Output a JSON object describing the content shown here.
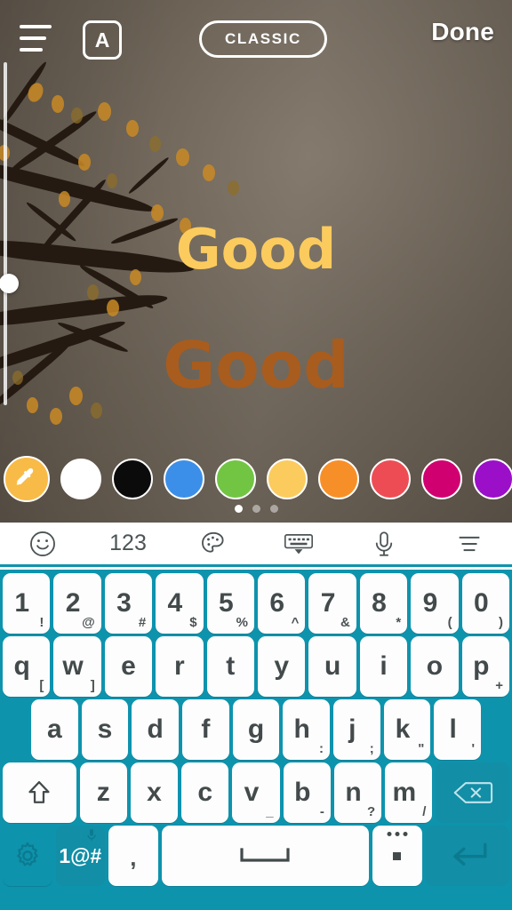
{
  "topbar": {
    "menu_icon": "hamburger-icon",
    "align_label": "A",
    "style_label": "CLASSIC",
    "done_label": "Done"
  },
  "canvas": {
    "texts": [
      {
        "value": "Good",
        "color": "#fbcb5e"
      },
      {
        "value": "Good",
        "color": "#a85c1e"
      }
    ],
    "slider": {
      "name": "text-size-slider",
      "value_pct": 44
    }
  },
  "palette": {
    "selected_index": 0,
    "swatches": [
      {
        "name": "eyedropper",
        "color": "#f8bb47"
      },
      {
        "name": "white",
        "color": "#ffffff"
      },
      {
        "name": "black",
        "color": "#0b0b0b"
      },
      {
        "name": "blue",
        "color": "#3b8fe8"
      },
      {
        "name": "green",
        "color": "#72c543"
      },
      {
        "name": "yellow",
        "color": "#fbcb5e"
      },
      {
        "name": "orange",
        "color": "#f78f28"
      },
      {
        "name": "red",
        "color": "#ee4c54"
      },
      {
        "name": "magenta",
        "color": "#d10070"
      },
      {
        "name": "purple",
        "color": "#9b0fc9"
      }
    ],
    "page_dots": {
      "count": 3,
      "active": 0
    }
  },
  "kb_toolbar": {
    "items": [
      {
        "name": "emoji-icon",
        "label": ""
      },
      {
        "name": "numbers-toggle",
        "label": "123"
      },
      {
        "name": "theme-palette-icon",
        "label": ""
      },
      {
        "name": "hide-keyboard-icon",
        "label": ""
      },
      {
        "name": "microphone-icon",
        "label": ""
      },
      {
        "name": "keyboard-menu-icon",
        "label": ""
      }
    ]
  },
  "keyboard": {
    "row_numbers": [
      {
        "main": "1",
        "sub": "!"
      },
      {
        "main": "2",
        "sub": "@"
      },
      {
        "main": "3",
        "sub": "#"
      },
      {
        "main": "4",
        "sub": "$"
      },
      {
        "main": "5",
        "sub": "%"
      },
      {
        "main": "6",
        "sub": "^"
      },
      {
        "main": "7",
        "sub": "&"
      },
      {
        "main": "8",
        "sub": "*"
      },
      {
        "main": "9",
        "sub": "("
      },
      {
        "main": "0",
        "sub": ")"
      }
    ],
    "row_top": [
      {
        "main": "q",
        "sub": "["
      },
      {
        "main": "w",
        "sub": "]"
      },
      {
        "main": "e",
        "sub": ""
      },
      {
        "main": "r",
        "sub": ""
      },
      {
        "main": "t",
        "sub": ""
      },
      {
        "main": "y",
        "sub": ""
      },
      {
        "main": "u",
        "sub": ""
      },
      {
        "main": "i",
        "sub": ""
      },
      {
        "main": "o",
        "sub": ""
      },
      {
        "main": "p",
        "sub": "+"
      }
    ],
    "row_home": [
      {
        "main": "a",
        "sub": ""
      },
      {
        "main": "s",
        "sub": ""
      },
      {
        "main": "d",
        "sub": ""
      },
      {
        "main": "f",
        "sub": ""
      },
      {
        "main": "g",
        "sub": ""
      },
      {
        "main": "h",
        "sub": ":"
      },
      {
        "main": "j",
        "sub": ";"
      },
      {
        "main": "k",
        "sub": "\""
      },
      {
        "main": "l",
        "sub": "'"
      }
    ],
    "row_bottom": [
      {
        "main": "z",
        "sub": ""
      },
      {
        "main": "x",
        "sub": ""
      },
      {
        "main": "c",
        "sub": ""
      },
      {
        "main": "v",
        "sub": "_"
      },
      {
        "main": "b",
        "sub": "-"
      },
      {
        "main": "n",
        "sub": "?"
      },
      {
        "main": "m",
        "sub": "/"
      }
    ],
    "shift_label": "",
    "backspace_label": "",
    "settings_label": "",
    "symbols_label": "1@#",
    "comma_label": ",",
    "space_label": "",
    "period_label": ".",
    "enter_label": ""
  },
  "colors": {
    "keyboard_bg": "#0e93ad",
    "key_bg": "#fdfdfd",
    "key_text": "#434a4b",
    "key_dark": "#128ea6",
    "accent_yellow": "#fbcb5e",
    "accent_brown": "#a85c1e"
  }
}
